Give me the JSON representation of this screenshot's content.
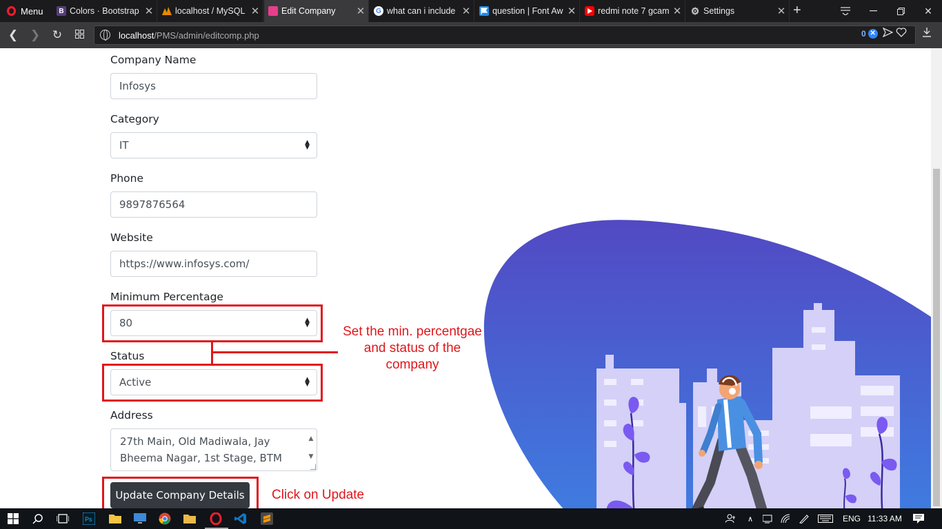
{
  "browser": {
    "menu_label": "Menu",
    "tabs": [
      {
        "title": "Colors · Bootstrap",
        "favicon_letter": "B",
        "favicon_color": "#563d7c"
      },
      {
        "title": "localhost / MySQL",
        "favicon_letter": "",
        "favicon_color": "#e68a00"
      },
      {
        "title": "Edit Company",
        "favicon_letter": "",
        "favicon_color": "#e83e8c"
      },
      {
        "title": "what can i include",
        "favicon_letter": "G",
        "favicon_color": "#ffffff"
      },
      {
        "title": "question | Font Aw",
        "favicon_letter": "",
        "favicon_color": "#228ae6"
      },
      {
        "title": "redmi note 7 gcam",
        "favicon_letter": "",
        "favicon_color": "#ff0000"
      },
      {
        "title": "Settings",
        "favicon_letter": "",
        "favicon_color": "#cccccc"
      }
    ],
    "active_tab": 2,
    "url_host": "localhost",
    "url_path": "/PMS/admin/editcomp.php",
    "adblock_count": "0"
  },
  "form": {
    "company_name": {
      "label": "Company Name",
      "value": "Infosys"
    },
    "category": {
      "label": "Category",
      "value": "IT"
    },
    "phone": {
      "label": "Phone",
      "value": "9897876564"
    },
    "website": {
      "label": "Website",
      "value": "https://www.infosys.com/"
    },
    "min_percentage": {
      "label": "Minimum Percentage",
      "value": "80"
    },
    "status": {
      "label": "Status",
      "value": "Active"
    },
    "address": {
      "label": "Address",
      "value": " 27th Main, Old Madiwala, Jay Bheema Nagar, 1st Stage, BTM"
    },
    "submit_label": "Update Company Details"
  },
  "annotations": {
    "note_select": [
      "Set the min. percentgae",
      "and status of the",
      "company"
    ],
    "note_update": "Click on Update",
    "color": "#e0161b"
  },
  "taskbar": {
    "language": "ENG",
    "time": "11:33 AM"
  },
  "colors": {
    "blob_top": "#5249c3",
    "blob_bottom": "#3f7be0",
    "button": "#343a40"
  }
}
